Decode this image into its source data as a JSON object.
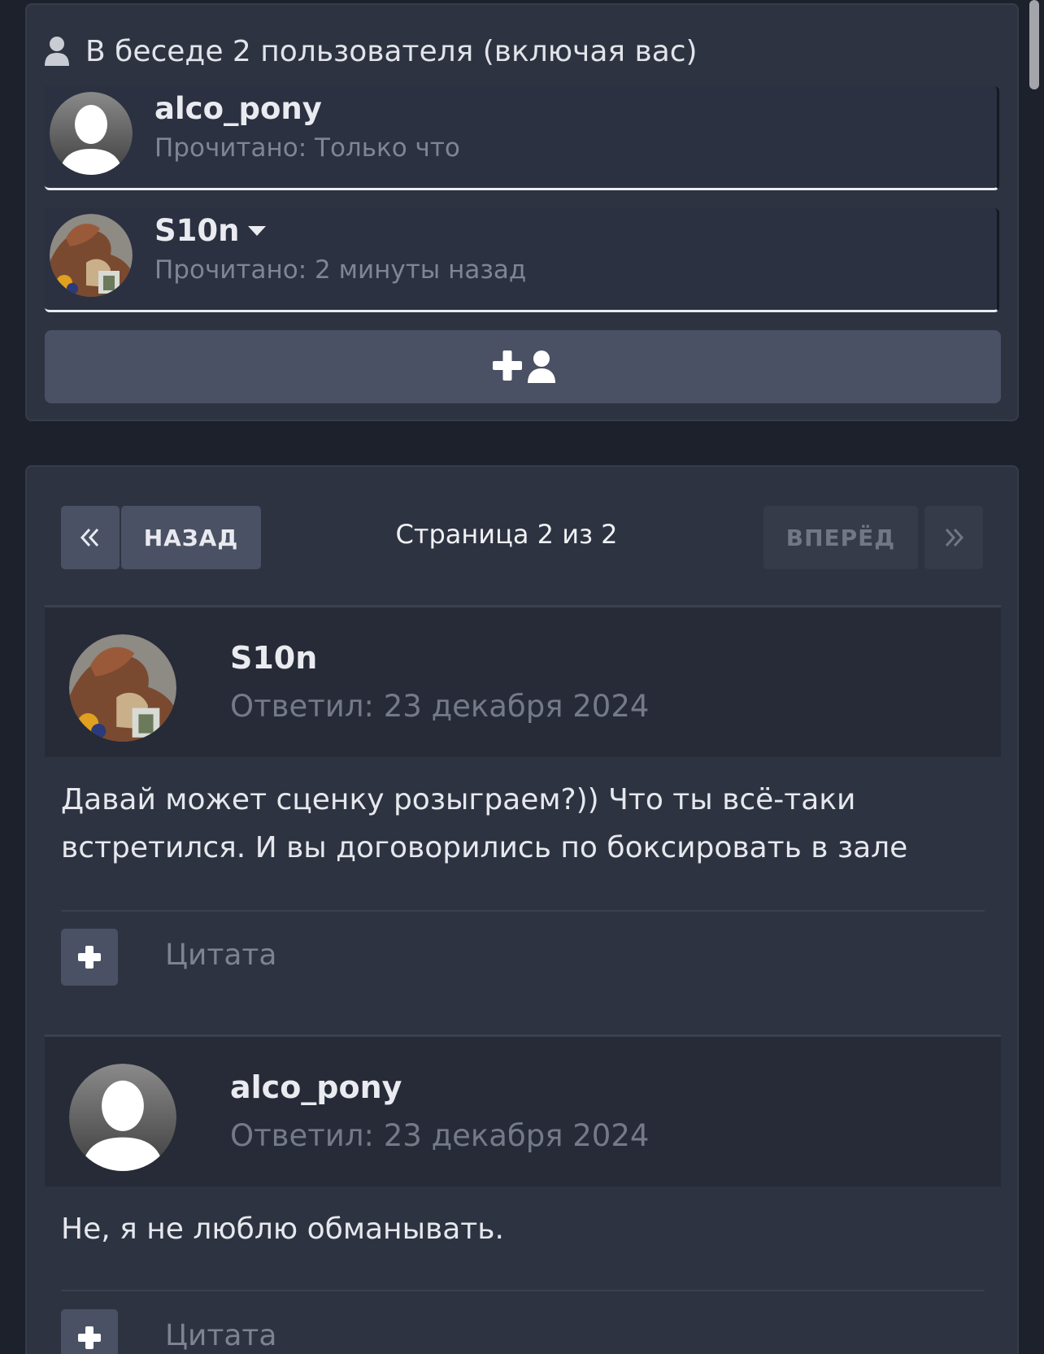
{
  "participants": {
    "title": "В беседе 2 пользователя (включая вас)",
    "members": [
      {
        "name": "alco_pony",
        "read": "Прочитано: Только что",
        "avatar": "default-user-avatar"
      },
      {
        "name": "S10n",
        "read": "Прочитано: 2 минуты назад",
        "avatar": "photo-avatar",
        "has_menu": true
      }
    ],
    "add_button_icon": "add-user-icon"
  },
  "pagination": {
    "first_label": "«",
    "prev_label": "НАЗАД",
    "page_label": "Страница 2 из 2",
    "next_label": "ВПЕРЁД",
    "last_label": "»"
  },
  "posts": [
    {
      "author": "S10n",
      "date": "Ответил: 23 декабря 2024",
      "body": "Давай может сценку розыграем?)) Что ты всё-таки встретился. И вы договорились по боксировать в зале",
      "quote_label": "Цитата"
    },
    {
      "author": "alco_pony",
      "date": "Ответил: 23 декабря 2024",
      "body": "Не, я не люблю обманывать.",
      "quote_label": "Цитата"
    }
  ],
  "colors": {
    "background": "#1d212b",
    "panel": "#2d3341",
    "button": "#4a5164",
    "muted_text": "#7f8594"
  }
}
